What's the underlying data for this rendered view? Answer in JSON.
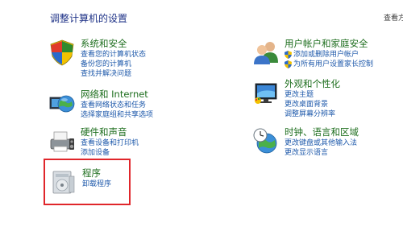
{
  "header": {
    "title": "调整计算机的设置",
    "view_by": "查看方"
  },
  "left_column": [
    {
      "title": "系统和安全",
      "icon": "shield-flag-icon",
      "links": [
        "查看您的计算机状态",
        "备份您的计算机",
        "查找并解决问题"
      ]
    },
    {
      "title": "网络和 Internet",
      "icon": "globe-network-icon",
      "links": [
        "查看网络状态和任务",
        "选择家庭组和共享选项"
      ]
    },
    {
      "title": "硬件和声音",
      "icon": "printer-icon",
      "links": [
        "查看设备和打印机",
        "添加设备"
      ]
    },
    {
      "title": "程序",
      "icon": "programs-icon",
      "links": [
        "卸载程序"
      ]
    }
  ],
  "right_column": [
    {
      "title": "用户帐户和家庭安全",
      "icon": "users-icon",
      "links": [
        "添加或删除用户帐户",
        "为所有用户设置家长控制"
      ]
    },
    {
      "title": "外观和个性化",
      "icon": "monitor-palette-icon",
      "links": [
        "更改主题",
        "更改桌面背景",
        "调整屏幕分辨率"
      ]
    },
    {
      "title": "时钟、语言和区域",
      "icon": "clock-globe-icon",
      "links": [
        "更改键盘或其他输入法",
        "更改显示语言"
      ]
    }
  ],
  "colors": {
    "title_green": "#1e6e1e",
    "link_blue": "#1f5aab",
    "highlight_red": "#e0262b"
  }
}
